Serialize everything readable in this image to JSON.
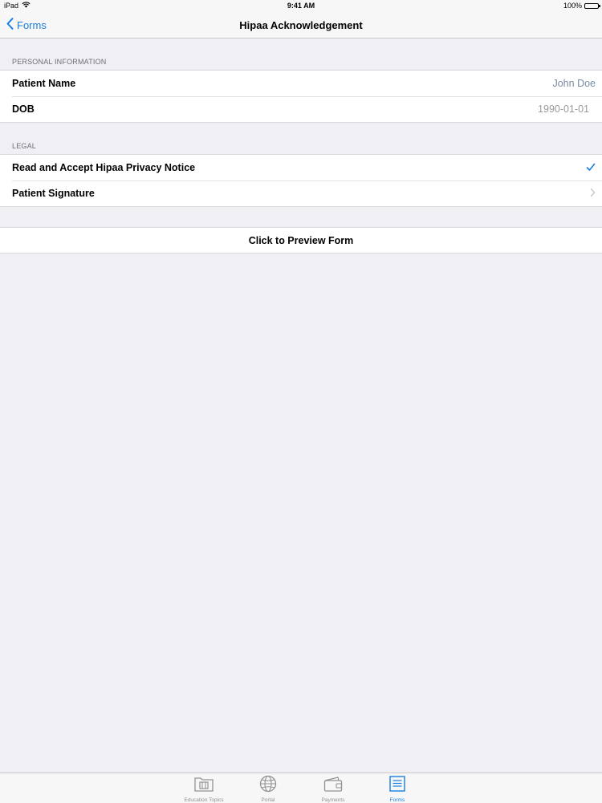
{
  "status_bar": {
    "device": "iPad",
    "time": "9:41 AM",
    "battery": "100%"
  },
  "nav": {
    "back_label": "Forms",
    "title": "Hipaa Acknowledgement"
  },
  "sections": {
    "personal": {
      "header": "PERSONAL INFORMATION",
      "rows": [
        {
          "label": "Patient Name",
          "value": "John Doe"
        },
        {
          "label": "DOB",
          "value": "1990-01-01"
        }
      ]
    },
    "legal": {
      "header": "LEGAL",
      "rows": [
        {
          "label": "Read and Accept Hipaa Privacy Notice",
          "accessory": "checkmark-icon"
        },
        {
          "label": "Patient Signature",
          "accessory": "chevron-right-icon"
        }
      ]
    }
  },
  "preview_button": "Click to Preview Form",
  "tabs": [
    {
      "label": "Education Topics",
      "icon": "film-folder-icon",
      "active": false
    },
    {
      "label": "Portal",
      "icon": "globe-icon",
      "active": false
    },
    {
      "label": "Payments",
      "icon": "wallet-icon",
      "active": false
    },
    {
      "label": "Forms",
      "icon": "document-icon",
      "active": true
    }
  ],
  "colors": {
    "accent": "#1a7ee0",
    "background": "#efeff4",
    "inactive_tab": "#929292"
  }
}
